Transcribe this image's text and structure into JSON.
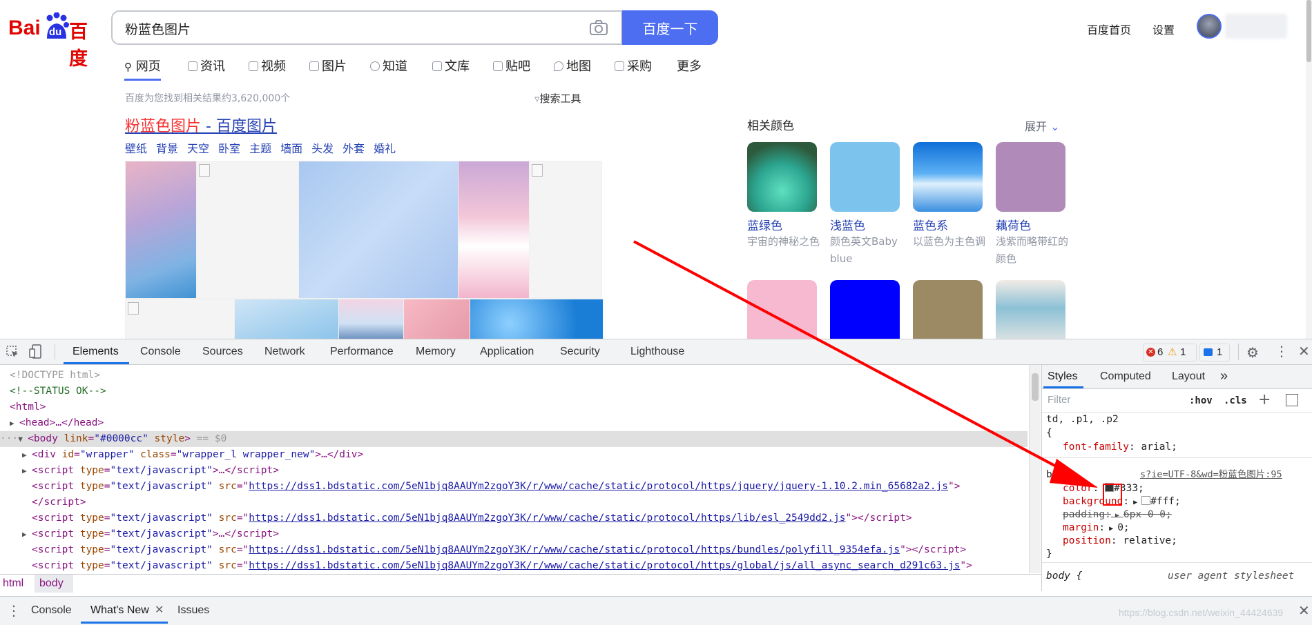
{
  "baidu": {
    "logo_text_left": "Bai",
    "logo_text_mid": "du",
    "logo_text_right": "百度",
    "search_value": "粉蓝色图片",
    "search_button": "百度一下",
    "home_link": "百度首页",
    "settings_link": "设置",
    "tabs": [
      "网页",
      "资讯",
      "视频",
      "图片",
      "知道",
      "文库",
      "贴吧",
      "地图",
      "采购",
      "更多"
    ],
    "result_count": "百度为您找到相关结果约3,620,000个",
    "search_tools": "搜索工具",
    "result_title_highlight": "粉蓝色图片",
    "result_title_rest": " - 百度图片",
    "sublinks": [
      "壁纸",
      "背景",
      "天空",
      "卧室",
      "主题",
      "墙面",
      "头发",
      "外套",
      "婚礼"
    ],
    "related_colors_title": "相关颜色",
    "expand": "展开",
    "related": [
      {
        "name": "蓝绿色",
        "desc": "宇宙的神秘之色"
      },
      {
        "name": "浅蓝色",
        "desc": "颜色英文Baby blue"
      },
      {
        "name": "蓝色系",
        "desc": "以蓝色为主色调"
      },
      {
        "name": "藕荷色",
        "desc": "浅紫而略带红的颜色"
      }
    ]
  },
  "devtools": {
    "tabs": [
      "Elements",
      "Console",
      "Sources",
      "Network",
      "Performance",
      "Memory",
      "Application",
      "Security",
      "Lighthouse"
    ],
    "errors": "6",
    "warnings": "1",
    "messages": "1",
    "dom_lines": {
      "doctype": "<!DOCTYPE html>",
      "comment": "<!--STATUS OK-->",
      "html_open": "<html>",
      "head": "<head>…</head>",
      "body_attrs_link": "\"#0000cc\"",
      "body_eq": " == $0",
      "div_id": "\"wrapper\"",
      "div_class": "\"wrapper_l wrapper_new\"",
      "script_type": "\"text/javascript\"",
      "src1": "https://dss1.bdstatic.com/5eN1bjq8AAUYm2zgoY3K/r/www/cache/static/protocol/https/jquery/jquery-1.10.2.min_65682a2.js",
      "src2": "https://dss1.bdstatic.com/5eN1bjq8AAUYm2zgoY3K/r/www/cache/static/protocol/https/lib/esl_2549dd2.js",
      "src3": "https://dss1.bdstatic.com/5eN1bjq8AAUYm2zgoY3K/r/www/cache/static/protocol/https/bundles/polyfill_9354efa.js",
      "src4": "https://dss1.bdstatic.com/5eN1bjq8AAUYm2zgoY3K/r/www/cache/static/protocol/https/global/js/all_async_search_d291c63.js"
    },
    "breadcrumb": [
      "html",
      "body"
    ],
    "styles_tabs": [
      "Styles",
      "Computed",
      "Layout"
    ],
    "filter_placeholder": "Filter",
    "hov": ":hov",
    "cls": ".cls",
    "rule1_selector": "td, .p1, .p2",
    "rule1_prop": "font-family",
    "rule1_val": "arial;",
    "rule2_selector": "body",
    "rule2_source": "s?ie=UTF-8&wd=粉蓝色图片:95",
    "rule2_props": [
      {
        "name": "color",
        "value": "#333;"
      },
      {
        "name": "background",
        "value": "#fff;"
      },
      {
        "name": "padding",
        "value": "6px 0 0;"
      },
      {
        "name": "margin",
        "value": "0;"
      },
      {
        "name": "position",
        "value": "relative;"
      }
    ],
    "rule3_selector": "body {",
    "rule3_source": "user agent stylesheet",
    "drawer_tabs": [
      "Console",
      "What's New",
      "Issues"
    ],
    "colors": {
      "accent": "#4e6ef2",
      "arrow": "#ff0000"
    }
  },
  "watermark": "https://blog.csdn.net/weixin_44424639"
}
